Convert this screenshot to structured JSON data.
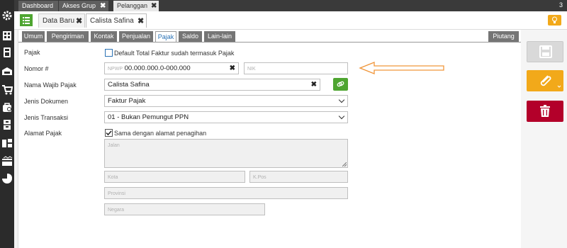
{
  "top_tabs": [
    {
      "label": "Dashboard"
    },
    {
      "label": "Akses Grup",
      "close": "✖"
    },
    {
      "label": "Pelanggan",
      "close": "✖"
    }
  ],
  "window_count": "3",
  "second_tabs": [
    {
      "label": "Data Baru",
      "close": "✖"
    },
    {
      "label": "Calista Safina",
      "close": "✖"
    }
  ],
  "form_tabs": [
    "Umum",
    "Pengiriman",
    "Kontak",
    "Penjualan",
    "Pajak",
    "Saldo",
    "Lain-lain"
  ],
  "piutang_tab": "Piutang",
  "form": {
    "pajak_label": "Pajak",
    "pajak_check_label": "Default Total Faktur sudah termasuk Pajak",
    "nomor_label": "Nomor #",
    "npwp_prefix": "NPWP",
    "npwp_value": "00.000.000.0-000.000",
    "nik_placeholder": "NIK",
    "nama_label": "Nama Wajib Pajak",
    "nama_value": "Calista Safina",
    "jenis_dok_label": "Jenis Dokumen",
    "jenis_dok_value": "Faktur Pajak",
    "jenis_trans_label": "Jenis Transaksi",
    "jenis_trans_value": "01 - Bukan Pemungut PPN",
    "alamat_label": "Alamat Pajak",
    "alamat_check_label": "Sama dengan alamat penagihan",
    "jalan_placeholder": "Jalan",
    "kota_placeholder": "Kota",
    "kpos_placeholder": "K.Pos",
    "provinsi_placeholder": "Provinsi",
    "negara_placeholder": "Negara"
  },
  "icons": {
    "gear": "gear-icon",
    "building": "building-icon",
    "calculator": "calculator-icon",
    "cart": "cart-icon",
    "bag": "bag-icon",
    "cabinet": "cabinet-icon",
    "save": "save-icon",
    "attach": "paperclip-icon",
    "delete": "trash-icon"
  },
  "colors": {
    "green": "#4ea531",
    "orange": "#f2a91a",
    "red": "#b3002a",
    "tab_active": "#2a72b5"
  }
}
